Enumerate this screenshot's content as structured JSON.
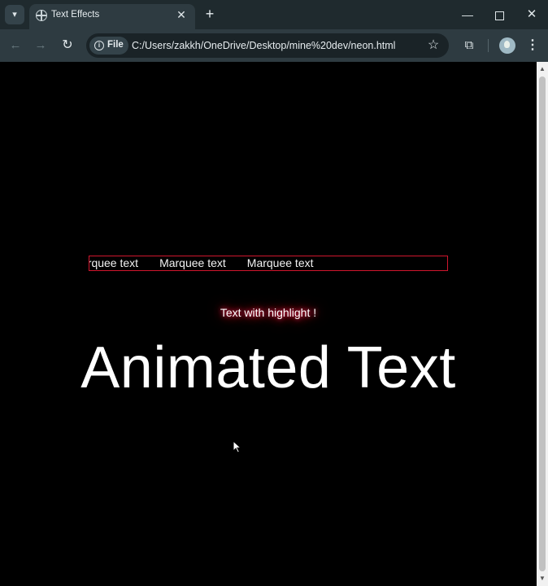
{
  "browser": {
    "tab_menu_icon": "chevron-down-icon",
    "tab": {
      "title": "Text Effects",
      "favicon": "globe-icon",
      "close_glyph": "✕"
    },
    "new_tab_glyph": "+",
    "window": {
      "minimize_glyph": "—",
      "close_glyph": "✕"
    },
    "toolbar": {
      "back_glyph": "←",
      "forward_glyph": "→",
      "reload_glyph": "↻",
      "site_label": "File",
      "url": "C:/Users/zakkh/OneDrive/Desktop/mine%20dev/neon.html",
      "bookmark_glyph": "☆",
      "extensions_glyph": "⧉",
      "menu_glyph": "⋮"
    }
  },
  "page": {
    "marquee_items": [
      "arquee text",
      "Marquee text",
      "Marquee text"
    ],
    "marquee_border_color": "#d0162e",
    "highlight_text": "Text with highlight !",
    "highlight_glow_color": "#ff2a55",
    "animated_text": "Animated Text"
  },
  "scrollbar": {
    "up_glyph": "▲",
    "down_glyph": "▼"
  }
}
